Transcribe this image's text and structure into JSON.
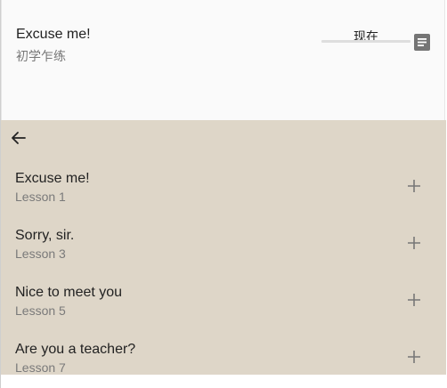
{
  "header": {
    "title": "Excuse me!",
    "subtitle": "初学乍练",
    "time_label": "现在",
    "icon": "document-icon"
  },
  "sheet": {
    "back_icon": "arrow-back-icon",
    "add_icon": "plus-icon",
    "background": "#ded6c8",
    "items": [
      {
        "title": "Excuse me!",
        "subtitle": "Lesson 1"
      },
      {
        "title": "Sorry, sir.",
        "subtitle": "Lesson 3"
      },
      {
        "title": "Nice to meet you",
        "subtitle": "Lesson 5"
      },
      {
        "title": "Are you a teacher?",
        "subtitle": "Lesson 7"
      }
    ]
  }
}
